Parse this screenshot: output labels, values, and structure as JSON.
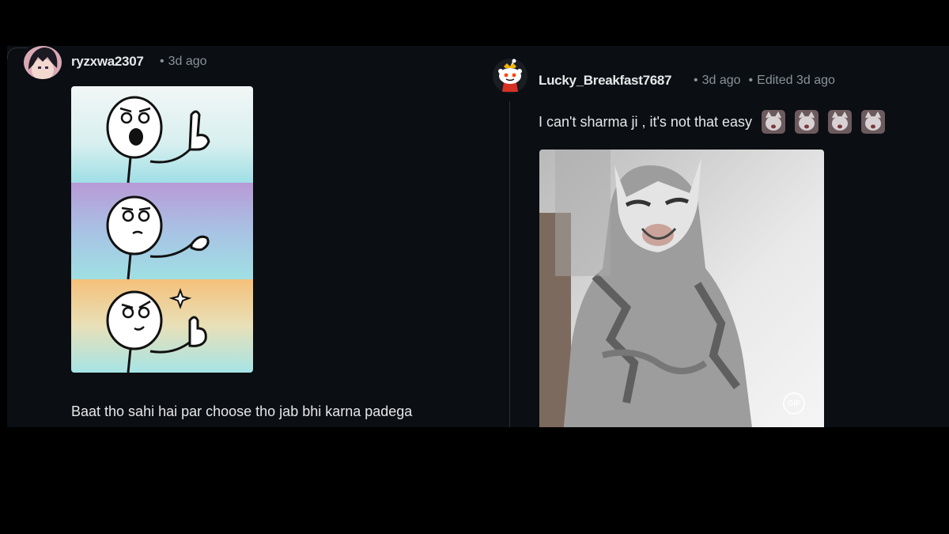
{
  "comments": [
    {
      "author": "ryzxwa2307",
      "time": "3d ago",
      "avatar_icon": "anime-avatar-icon",
      "media": "meme-three-panel-image",
      "body": "Baat tho sahi hai par choose tho jab bhi karna padega"
    },
    {
      "author": "Lucky_Breakfast7687",
      "time": "3d ago",
      "edited": "Edited 3d ago",
      "avatar_icon": "snoo-avatar-icon",
      "body": "I can't sharma ji , it's not that easy",
      "emoji_icon": "laughing-cat-emoji-icon",
      "emoji_count": 4,
      "media": "laughing-cat-gif",
      "gif_badge": "GIF"
    }
  ],
  "colors": {
    "background": "#000000",
    "panel": "#0b0e12",
    "text": "#e6e8ea",
    "meta": "#8a9299",
    "thread_line": "#2a2f36"
  }
}
